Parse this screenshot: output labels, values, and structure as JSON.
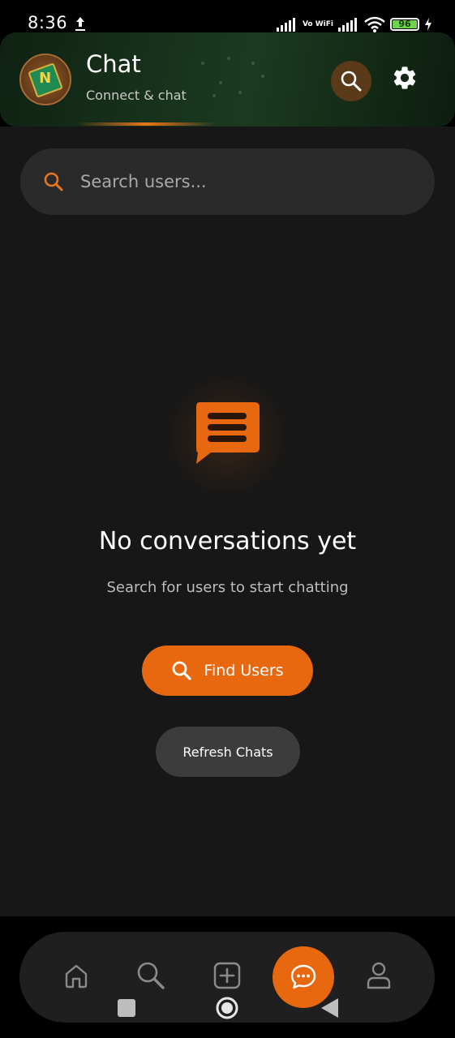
{
  "status_bar": {
    "time": "8:36",
    "battery_level": "96",
    "network_label": "Vo WiFi",
    "icons": [
      "upload-icon",
      "signal-icon",
      "vowifi-icon",
      "signal-icon",
      "wifi-icon",
      "battery-icon",
      "charging-icon"
    ]
  },
  "header": {
    "title": "Chat",
    "subtitle": "Connect & chat",
    "icons": {
      "search": "search-icon",
      "settings": "gear-icon"
    },
    "colors": {
      "background": "#17321c",
      "accent": "#e8761a"
    }
  },
  "search": {
    "placeholder": "Search users...",
    "value": ""
  },
  "empty_state": {
    "icon": "chat-bubble-icon",
    "title": "No conversations yet",
    "subtitle": "Search for users to start chatting",
    "primary_button": "Find Users",
    "secondary_button": "Refresh Chats"
  },
  "bottom_nav": {
    "items": [
      {
        "icon": "home-icon",
        "active": false
      },
      {
        "icon": "search-icon",
        "active": false
      },
      {
        "icon": "add-icon",
        "active": false
      },
      {
        "icon": "chat-icon",
        "active": true
      },
      {
        "icon": "profile-icon",
        "active": false
      }
    ]
  },
  "theme": {
    "accent": "#e8680f",
    "background": "#171717",
    "surface": "#2a2a2a"
  }
}
